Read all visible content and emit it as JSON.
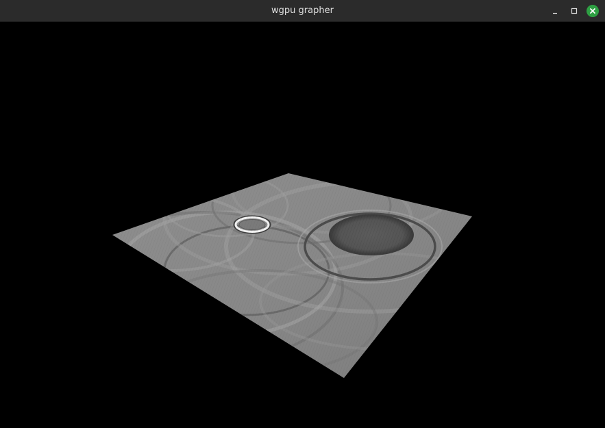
{
  "window": {
    "title": "wgpu grapher",
    "controls": {
      "minimize_icon": "minimize-icon",
      "maximize_icon": "maximize-icon",
      "close_icon": "close-icon"
    },
    "colors": {
      "titlebar": "#2b2b2b",
      "title_text": "#e0e0e0",
      "close_button": "#2ea043",
      "background": "#000000",
      "surface": "#8c8c8c"
    }
  },
  "scene": {
    "description_icon": "3d-wave-surface-plot"
  }
}
